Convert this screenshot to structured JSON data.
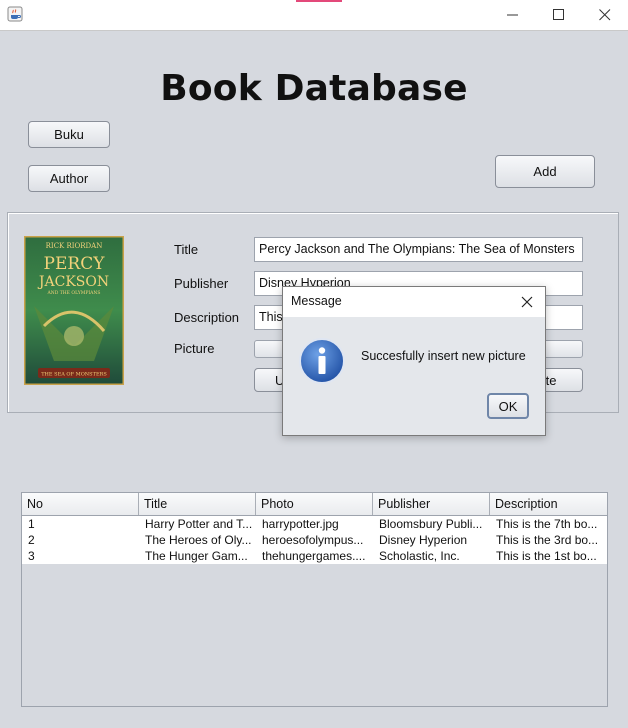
{
  "window": {
    "icon": "java-coffee-icon",
    "controls": [
      "minimize-icon",
      "maximize-icon",
      "close-icon"
    ]
  },
  "heading": "Book Database",
  "nav": {
    "buku_label": "Buku",
    "author_label": "Author",
    "add_label": "Add"
  },
  "form": {
    "title_label": "Title",
    "title_value": "Percy Jackson and The Olympians: The Sea of Monsters",
    "publisher_label": "Publisher",
    "publisher_value": "Disney Hyperion",
    "description_label": "Description",
    "description_value": "This",
    "picture_label": "Picture",
    "picture_value": "",
    "upload_label": "U",
    "delete_label": "ete",
    "cover": {
      "author": "RICK RIORDAN",
      "title_line1": "PERCY",
      "title_line2": "JACKSON",
      "subtitle": "AND THE OLYMPIANS",
      "book": "THE SEA OF MONSTERS"
    }
  },
  "table": {
    "columns": [
      "No",
      "Title",
      "Photo",
      "Publisher",
      "Description"
    ],
    "rows": [
      [
        "1",
        "Harry Potter and T...",
        "harrypotter.jpg",
        "Bloomsbury Publi...",
        "This is the 7th bo..."
      ],
      [
        "2",
        "The Heroes of Oly...",
        "heroesofolympus...",
        "Disney Hyperion",
        "This is the 3rd bo..."
      ],
      [
        "3",
        "The Hunger Gam...",
        "thehungergames....",
        "Scholastic, Inc.",
        "This is the 1st bo..."
      ]
    ]
  },
  "dialog": {
    "title": "Message",
    "icon": "info-icon",
    "message": "Succesfully insert new picture",
    "ok_label": "OK"
  },
  "colors": {
    "background": "#d6d9df",
    "info_blue": "#2f62b8",
    "ok_border": "#6f86a8"
  }
}
